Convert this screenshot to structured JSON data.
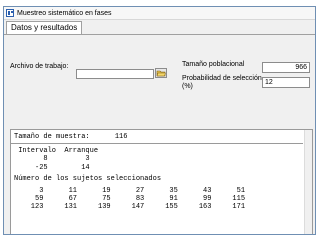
{
  "window": {
    "title": "Muestreo sistemático en fases"
  },
  "tabs": [
    {
      "label": "Datos y resultados"
    }
  ],
  "form": {
    "archivo_label": "Archivo de trabajo:",
    "archivo_value": "",
    "tamano_label": "Tamaño poblacional",
    "tamano_value": "966",
    "probabilidad_label_1": "Probabilidad de selección",
    "probabilidad_label_2": "(%)",
    "probabilidad_value": "12"
  },
  "output": {
    "tamano_line": "Tamaño de muestra:      116",
    "table_header": " Intervalo  Arranque",
    "rows": [
      "       8         3",
      "     -25        14"
    ],
    "subjects_header": "Número de los sujetos seleccionados",
    "subject_rows": [
      "      3      11      19      27      35      43      51",
      "     59      67      75      83      91      99     115",
      "    123     131     139     147     155     163     171"
    ]
  },
  "icons": {
    "app": "app-icon",
    "open_file": "folder-open-icon"
  }
}
